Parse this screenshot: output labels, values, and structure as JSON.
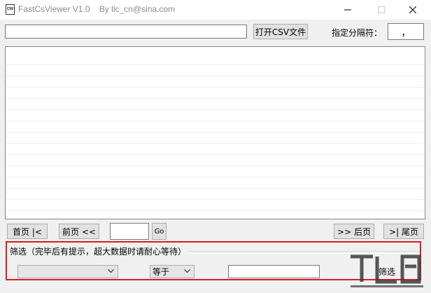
{
  "window": {
    "title": "FastCsViewer V1.0    By llc_cn@sina.com",
    "app_icon_text": "CSV"
  },
  "toolbar": {
    "file_path_value": "",
    "open_csv_label": "打开CSV文件",
    "delimiter_label": "指定分隔符：",
    "delimiter_value": "，"
  },
  "navigation": {
    "first_page_label": "首页 |<",
    "prev_page_label": "前页 <<",
    "page_number_value": "",
    "go_label": "Go",
    "next_page_label": ">> 后页",
    "last_page_label": ">| 尾页"
  },
  "filter": {
    "group_label": "筛选（完毕后有提示，超大数据时请耐心等待）",
    "column_selected": "",
    "operator_selected": "等于",
    "value": "",
    "filter_button_label": "筛选"
  },
  "colors": {
    "highlight_border": "#d81e1e",
    "watermark": "#3a3a3a"
  }
}
